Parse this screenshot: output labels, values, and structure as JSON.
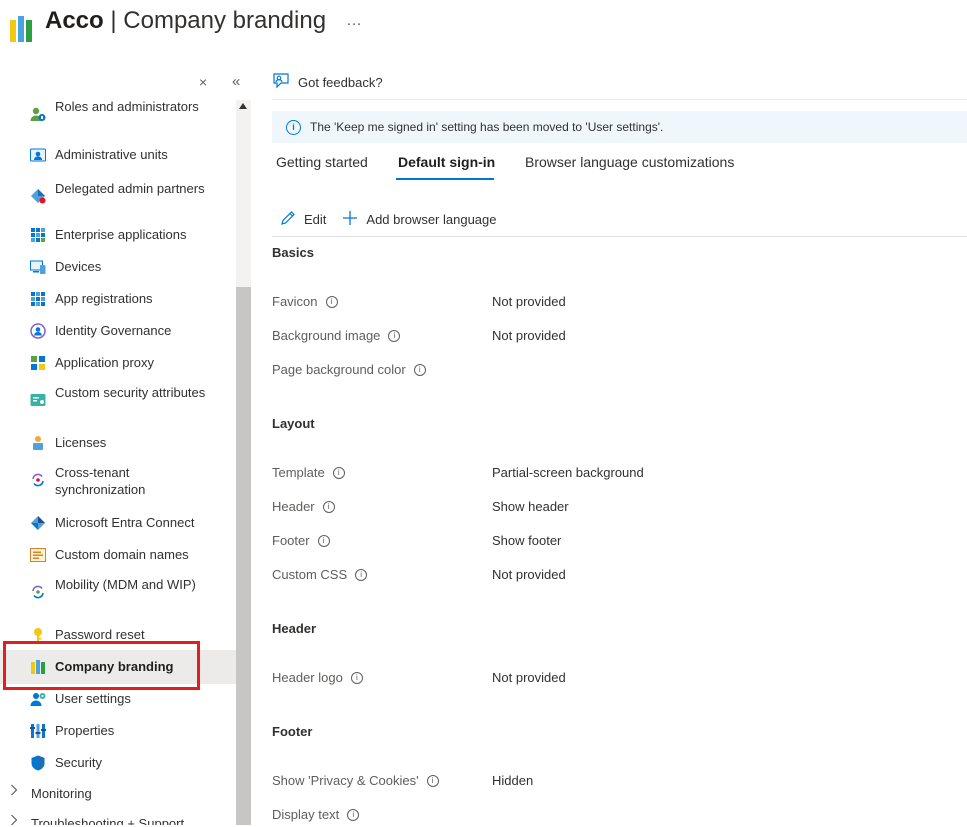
{
  "header": {
    "org": "Acco",
    "separator": " | ",
    "title": "Company branding",
    "more_icon": "…"
  },
  "sidebar": {
    "close_icon": "×",
    "collapse_icon": "«",
    "items": [
      {
        "label": "Roles and administrators",
        "icon": "roles-icon"
      },
      {
        "label": "Administrative units",
        "icon": "admin-units-icon"
      },
      {
        "label": "Delegated admin partners",
        "icon": "delegated-admin-icon"
      },
      {
        "label": "Enterprise applications",
        "icon": "enterprise-apps-icon"
      },
      {
        "label": "Devices",
        "icon": "devices-icon"
      },
      {
        "label": "App registrations",
        "icon": "app-registrations-icon"
      },
      {
        "label": "Identity Governance",
        "icon": "identity-governance-icon"
      },
      {
        "label": "Application proxy",
        "icon": "application-proxy-icon"
      },
      {
        "label": "Custom security attributes",
        "icon": "custom-security-attributes-icon"
      },
      {
        "label": "Licenses",
        "icon": "licenses-icon"
      },
      {
        "label": "Cross-tenant synchronization",
        "icon": "cross-tenant-sync-icon"
      },
      {
        "label": "Microsoft Entra Connect",
        "icon": "entra-connect-icon"
      },
      {
        "label": "Custom domain names",
        "icon": "custom-domain-icon"
      },
      {
        "label": "Mobility (MDM and WIP)",
        "icon": "mobility-icon"
      },
      {
        "label": "Password reset",
        "icon": "password-reset-icon"
      },
      {
        "label": "Company branding",
        "icon": "company-branding-icon",
        "active": true
      },
      {
        "label": "User settings",
        "icon": "user-settings-icon"
      },
      {
        "label": "Properties",
        "icon": "properties-icon"
      },
      {
        "label": "Security",
        "icon": "security-shield-icon"
      }
    ],
    "groups": [
      {
        "label": "Monitoring"
      },
      {
        "label": "Troubleshooting + Support"
      }
    ]
  },
  "main": {
    "feedback_label": "Got feedback?",
    "info_banner": "The 'Keep me signed in' setting has been moved to 'User settings'.",
    "tabs": [
      {
        "label": "Getting started"
      },
      {
        "label": "Default sign-in",
        "active": true
      },
      {
        "label": "Browser language customizations"
      }
    ],
    "toolbar": {
      "edit_label": "Edit",
      "add_language_label": "Add browser language"
    },
    "sections": {
      "basics": {
        "title": "Basics",
        "rows": [
          {
            "name": "Favicon",
            "value": "Not provided"
          },
          {
            "name": "Background image",
            "value": "Not provided"
          },
          {
            "name": "Page background color",
            "value": ""
          }
        ]
      },
      "layout": {
        "title": "Layout",
        "rows": [
          {
            "name": "Template",
            "value": "Partial-screen background"
          },
          {
            "name": "Header",
            "value": "Show header"
          },
          {
            "name": "Footer",
            "value": "Show footer"
          },
          {
            "name": "Custom CSS",
            "value": "Not provided"
          }
        ]
      },
      "header": {
        "title": "Header",
        "rows": [
          {
            "name": "Header logo",
            "value": "Not provided"
          }
        ]
      },
      "footer": {
        "title": "Footer",
        "rows": [
          {
            "name": "Show 'Privacy & Cookies'",
            "value": "Hidden"
          },
          {
            "name": "Display text",
            "value": ""
          }
        ]
      }
    }
  },
  "colors": {
    "accent": "#0078d4",
    "highlight": "#e02020",
    "banner_bg": "#eff6fc",
    "active_item_bg": "#edebe9"
  }
}
